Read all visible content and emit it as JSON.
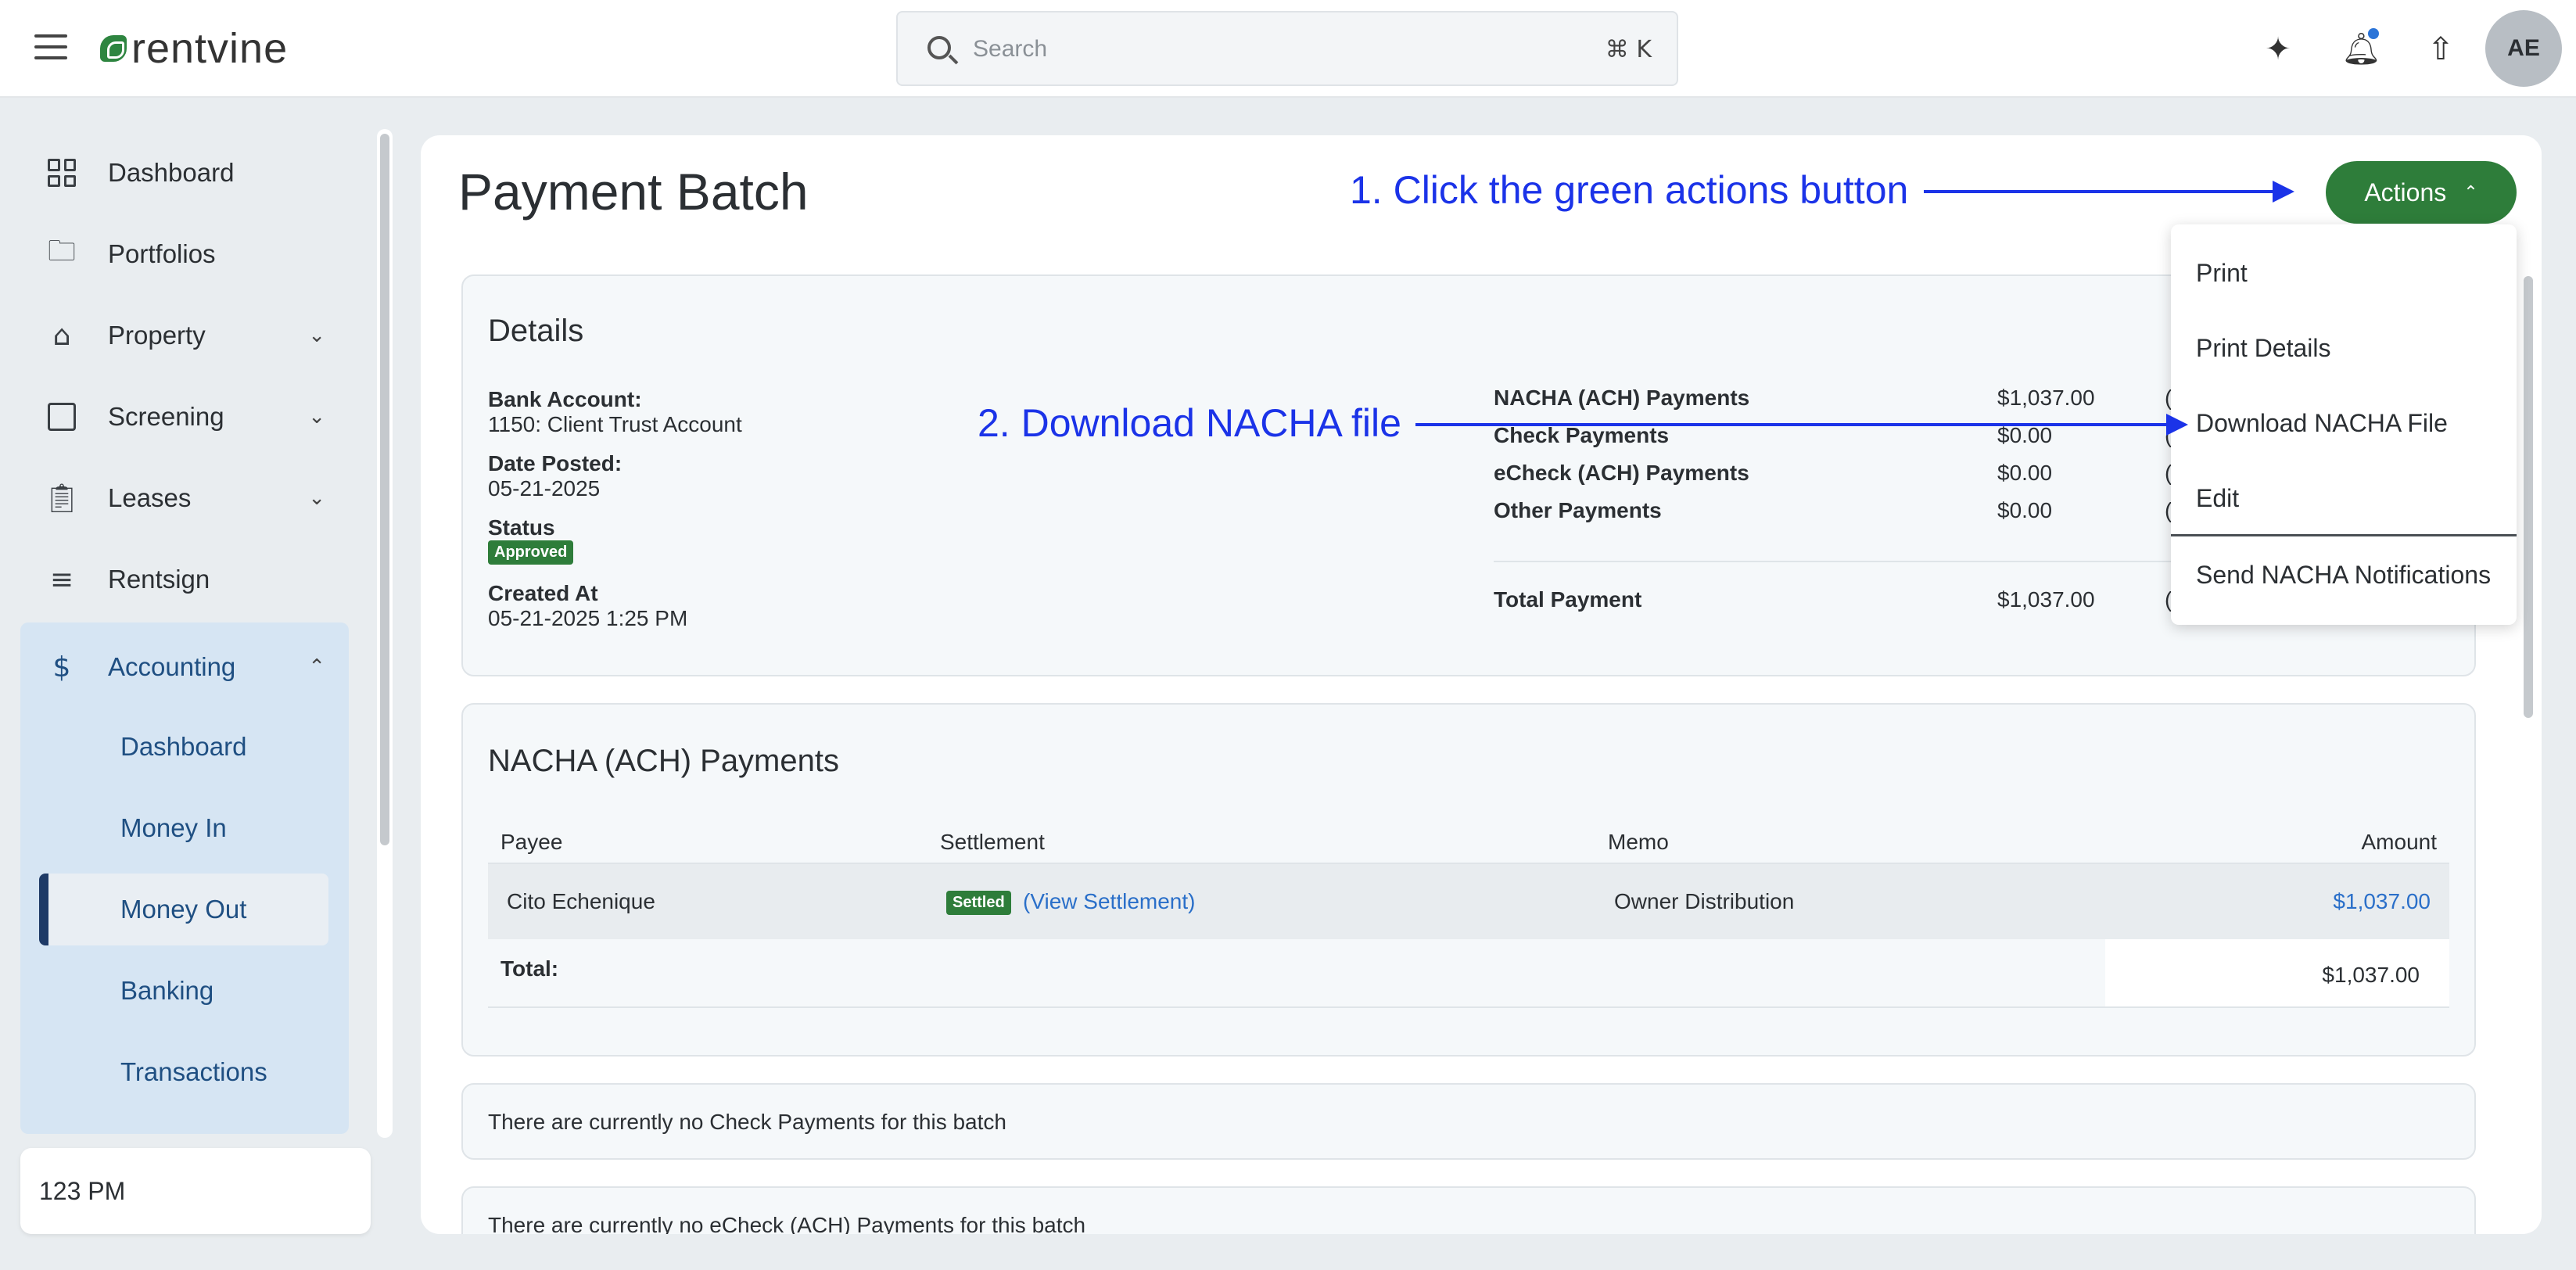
{
  "header": {
    "logo_text": "rentvine",
    "search_placeholder": "Search",
    "search_shortcut": "⌘ K",
    "avatar_initials": "AE"
  },
  "sidebar": {
    "items": [
      {
        "label": "Dashboard",
        "icon": "dashboard-grid-icon"
      },
      {
        "label": "Portfolios",
        "icon": "folders-icon"
      },
      {
        "label": "Property",
        "icon": "building-icon"
      },
      {
        "label": "Screening",
        "icon": "screening-icon"
      },
      {
        "label": "Leases",
        "icon": "clipboard-icon"
      },
      {
        "label": "Rentsign",
        "icon": "signature-icon"
      },
      {
        "label": "Accounting",
        "icon": "dollar-icon"
      }
    ],
    "accounting_sub": [
      {
        "label": "Dashboard"
      },
      {
        "label": "Money In"
      },
      {
        "label": "Money Out"
      },
      {
        "label": "Banking"
      },
      {
        "label": "Transactions"
      }
    ],
    "location": "123 PM"
  },
  "page": {
    "title": "Payment Batch",
    "actions_label": "Actions"
  },
  "details": {
    "title": "Details",
    "bank_account_label": "Bank Account:",
    "bank_account_value": "1150: Client Trust Account",
    "date_posted_label": "Date Posted:",
    "date_posted_value": "05-21-2025",
    "status_label": "Status",
    "status_value": "Approved",
    "created_at_label": "Created At",
    "created_at_value": "05-21-2025 1:25 PM",
    "summary": [
      {
        "label": "NACHA (ACH) Payments",
        "value": "$1,037.00",
        "paren": "("
      },
      {
        "label": "Check Payments",
        "value": "$0.00",
        "paren": "("
      },
      {
        "label": "eCheck (ACH) Payments",
        "value": "$0.00",
        "paren": "("
      },
      {
        "label": "Other Payments",
        "value": "$0.00",
        "paren": "("
      }
    ],
    "total_label": "Total Payment",
    "total_value": "$1,037.00",
    "total_paren": "("
  },
  "nacha": {
    "title": "NACHA (ACH) Payments",
    "columns": [
      "Payee",
      "Settlement",
      "Memo",
      "Amount"
    ],
    "row": {
      "payee": "Cito Echenique",
      "settlement_badge": "Settled",
      "settlement_link": "(View Settlement)",
      "memo": "Owner Distribution",
      "amount": "$1,037.00"
    },
    "total_label": "Total:",
    "total_value": "$1,037.00"
  },
  "empty": {
    "check": "There are currently no Check Payments for this batch",
    "echeck": "There are currently no eCheck (ACH) Payments for this batch"
  },
  "dropdown": {
    "items": [
      "Print",
      "Print Details",
      "Download NACHA File",
      "Edit",
      "Send NACHA Notifications"
    ]
  },
  "annotations": {
    "step1": "1. Click the green actions button",
    "step2": "2. Download NACHA file"
  },
  "colors": {
    "accent_green": "#2e7d3a",
    "annotation_blue": "#1b33e8",
    "link_blue": "#2a6fc9",
    "sidebar_active_bg": "#d6e5f3"
  }
}
